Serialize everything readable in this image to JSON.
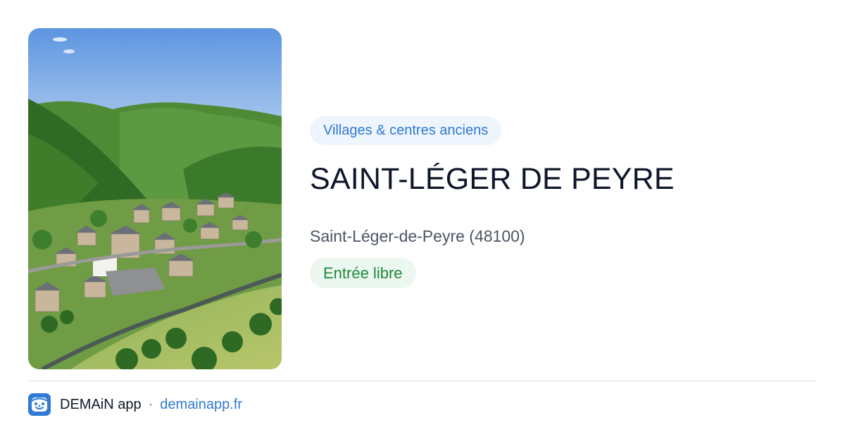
{
  "photo": {
    "alt": "Saint-Léger de Peyre"
  },
  "category": {
    "label": "Villages & centres anciens"
  },
  "place": {
    "title": "SAINT-LÉGER DE PEYRE",
    "location": "Saint-Léger-de-Peyre (48100)"
  },
  "access": {
    "label": "Entrée libre"
  },
  "footer": {
    "app_name": "DEMAiN app",
    "separator": "·",
    "domain": "demainapp.fr",
    "logo_icon": "demain-app-logo-icon"
  },
  "colors": {
    "accent_blue": "#2f7ad4",
    "category_bg": "#eef5fd",
    "access_green": "#1f8a3c",
    "access_bg": "#ecf7ef",
    "title": "#0f172a",
    "subtitle": "#4b5563"
  }
}
